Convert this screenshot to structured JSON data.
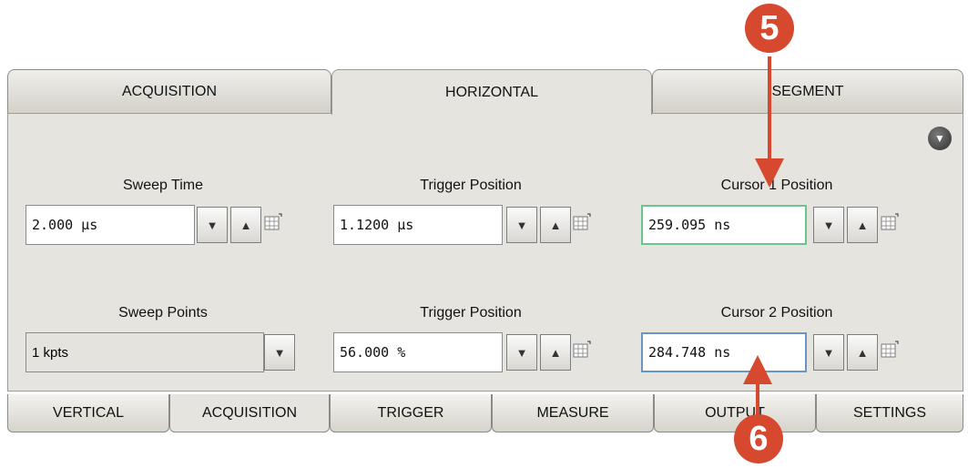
{
  "top_tabs": [
    "ACQUISITION",
    "HORIZONTAL",
    "SEGMENT"
  ],
  "bottom_tabs": [
    "VERTICAL",
    "ACQUISITION",
    "TRIGGER",
    "MEASURE",
    "OUTPUT",
    "SETTINGS"
  ],
  "fields": {
    "sweep_time": {
      "label": "Sweep Time",
      "value": "2.000 µs"
    },
    "trigger_position_time": {
      "label": "Trigger Position",
      "value": "1.1200 µs"
    },
    "cursor1": {
      "label": "Cursor 1 Position",
      "value": "259.095 ns"
    },
    "sweep_points": {
      "label": "Sweep Points",
      "value": "1 kpts"
    },
    "trigger_position_percent": {
      "label": "Trigger Position",
      "value": "56.000 %"
    },
    "cursor2": {
      "label": "Cursor 2 Position",
      "value": "284.748 ns"
    }
  },
  "markers": {
    "top": "5",
    "bottom": "6"
  },
  "colors": {
    "marker": "#d6492f",
    "cursor1_border": "#69c58c",
    "cursor2_border": "#6a94c4"
  }
}
